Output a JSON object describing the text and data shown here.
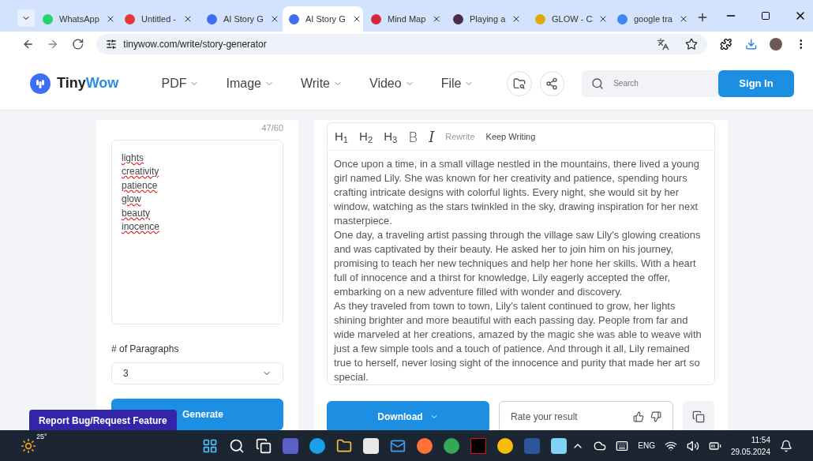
{
  "browser": {
    "tabs": [
      {
        "title": "WhatsApp",
        "selected": false,
        "color": "#25d366"
      },
      {
        "title": "Untitled - ",
        "selected": false,
        "color": "#e53935"
      },
      {
        "title": "AI Story G",
        "selected": false,
        "color": "#3b6ff5"
      },
      {
        "title": "AI Story G",
        "selected": true,
        "color": "#3b6ff5"
      },
      {
        "title": "Mind Map",
        "selected": false,
        "color": "#d62839"
      },
      {
        "title": "Playing a",
        "selected": false,
        "color": "#4a2c4a"
      },
      {
        "title": "GLOW - C",
        "selected": false,
        "color": "#e0a800"
      },
      {
        "title": "google tra",
        "selected": false,
        "color": "#4285f4"
      }
    ],
    "address": "tinywow.com/write/story-generator"
  },
  "header": {
    "logo_prefix": "Tiny",
    "logo_suffix": "Wow",
    "nav": [
      "PDF",
      "Image",
      "Write",
      "Video",
      "File"
    ],
    "search": {
      "placeholder": "Search"
    },
    "sign_in": "Sign In"
  },
  "form": {
    "counter": "47/60",
    "keywords": [
      "lights",
      "creativity",
      "patience",
      "glow",
      "beauty",
      "inocence"
    ],
    "paragraphs_label": "# of Paragraphs",
    "paragraphs_value": "3",
    "generate": "Generate"
  },
  "editor": {
    "tools": [
      {
        "kind": "heading",
        "label": "H$_{1}$",
        "disabled": false
      },
      {
        "kind": "heading",
        "label": "H$_{2}$",
        "disabled": false
      },
      {
        "kind": "heading",
        "label": "H$_{3}$",
        "disabled": false
      },
      {
        "kind": "bold",
        "label": "B",
        "disabled": false
      },
      {
        "kind": "italic",
        "label": "I",
        "disabled": false
      },
      {
        "kind": "action",
        "label": "Rewrite",
        "disabled": true
      },
      {
        "kind": "action",
        "label": "Keep Writing",
        "disabled": false
      }
    ],
    "story": [
      "Once upon a time, in a small village nestled in the mountains, there lived a young girl named Lily. She was known for her creativity and patience, spending hours crafting intricate designs with colorful lights. Every night, she would sit by her window, watching as the stars twinkled in the sky, drawing inspiration for her next masterpiece.",
      "One day, a traveling artist passing through the village saw Lily's glowing creations and was captivated by their beauty. He asked her to join him on his journey, promising to teach her new techniques and help her hone her skills. With a heart full of innocence and a thirst for knowledge, Lily eagerly accepted the offer, embarking on a new adventure filled with wonder and discovery.",
      "As they traveled from town to town, Lily's talent continued to grow, her lights shining brighter and more beautiful with each passing day. People from far and wide marveled at her creations, amazed by the magic she was able to weave with just a few simple tools and a touch of patience. And through it all, Lily remained true to herself, never losing sight of the innocence and purity that made her art so special."
    ]
  },
  "actions": {
    "download": "Download",
    "rate_placeholder": "Rate your result"
  },
  "feedback": "Report Bug/Request Feature",
  "taskbar": {
    "weather": "25°",
    "language": "ENG",
    "time": "11:54",
    "date": "29.05.2024"
  }
}
